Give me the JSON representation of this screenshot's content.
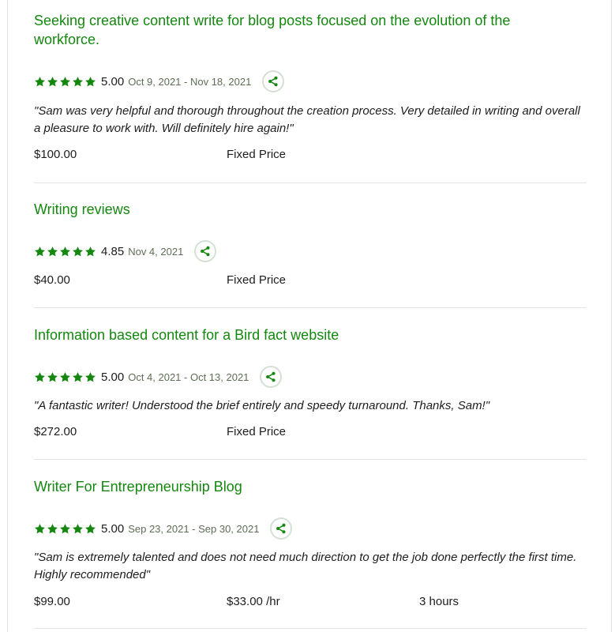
{
  "colors": {
    "accent": "#14870f",
    "text": "#1d1d1d",
    "muted": "#5e6d55",
    "divider": "#e4e4e4"
  },
  "icons": {
    "star": "star-icon",
    "share": "share-icon"
  },
  "jobs": [
    {
      "title": "Seeking creative content write for blog posts focused on the evolution of the workforce.",
      "stars": 5,
      "rating": "5.00",
      "dates": "Oct 9, 2021 - Nov 18, 2021",
      "feedback": "\"Sam was very helpful and thorough throughout the creation process. Very detailed in writing and overall a pleasure to work with. Will definitely hire again!\"",
      "amount": "$100.00",
      "price_type": "Fixed Price"
    },
    {
      "title": "Writing reviews",
      "stars": 5,
      "rating": "4.85",
      "dates": "Nov 4, 2021",
      "amount": "$40.00",
      "price_type": "Fixed Price"
    },
    {
      "title": "Information based content for a Bird fact website",
      "stars": 5,
      "rating": "5.00",
      "dates": "Oct 4, 2021 - Oct 13, 2021",
      "feedback": "\"A fantastic writer! Understood the brief entirely and speedy turnaround. Thanks, Sam!\"",
      "amount": "$272.00",
      "price_type": "Fixed Price"
    },
    {
      "title": "Writer For Entrepreneurship Blog",
      "stars": 5,
      "rating": "5.00",
      "dates": "Sep 23, 2021 - Sep 30, 2021",
      "feedback": "\"Sam is extremely talented and does not need much direction to get the job done perfectly the first time. Highly recommended\"",
      "amount": "$99.00",
      "rate": "$33.00",
      "rate_unit": "/hr",
      "hours": "3 hours"
    }
  ]
}
